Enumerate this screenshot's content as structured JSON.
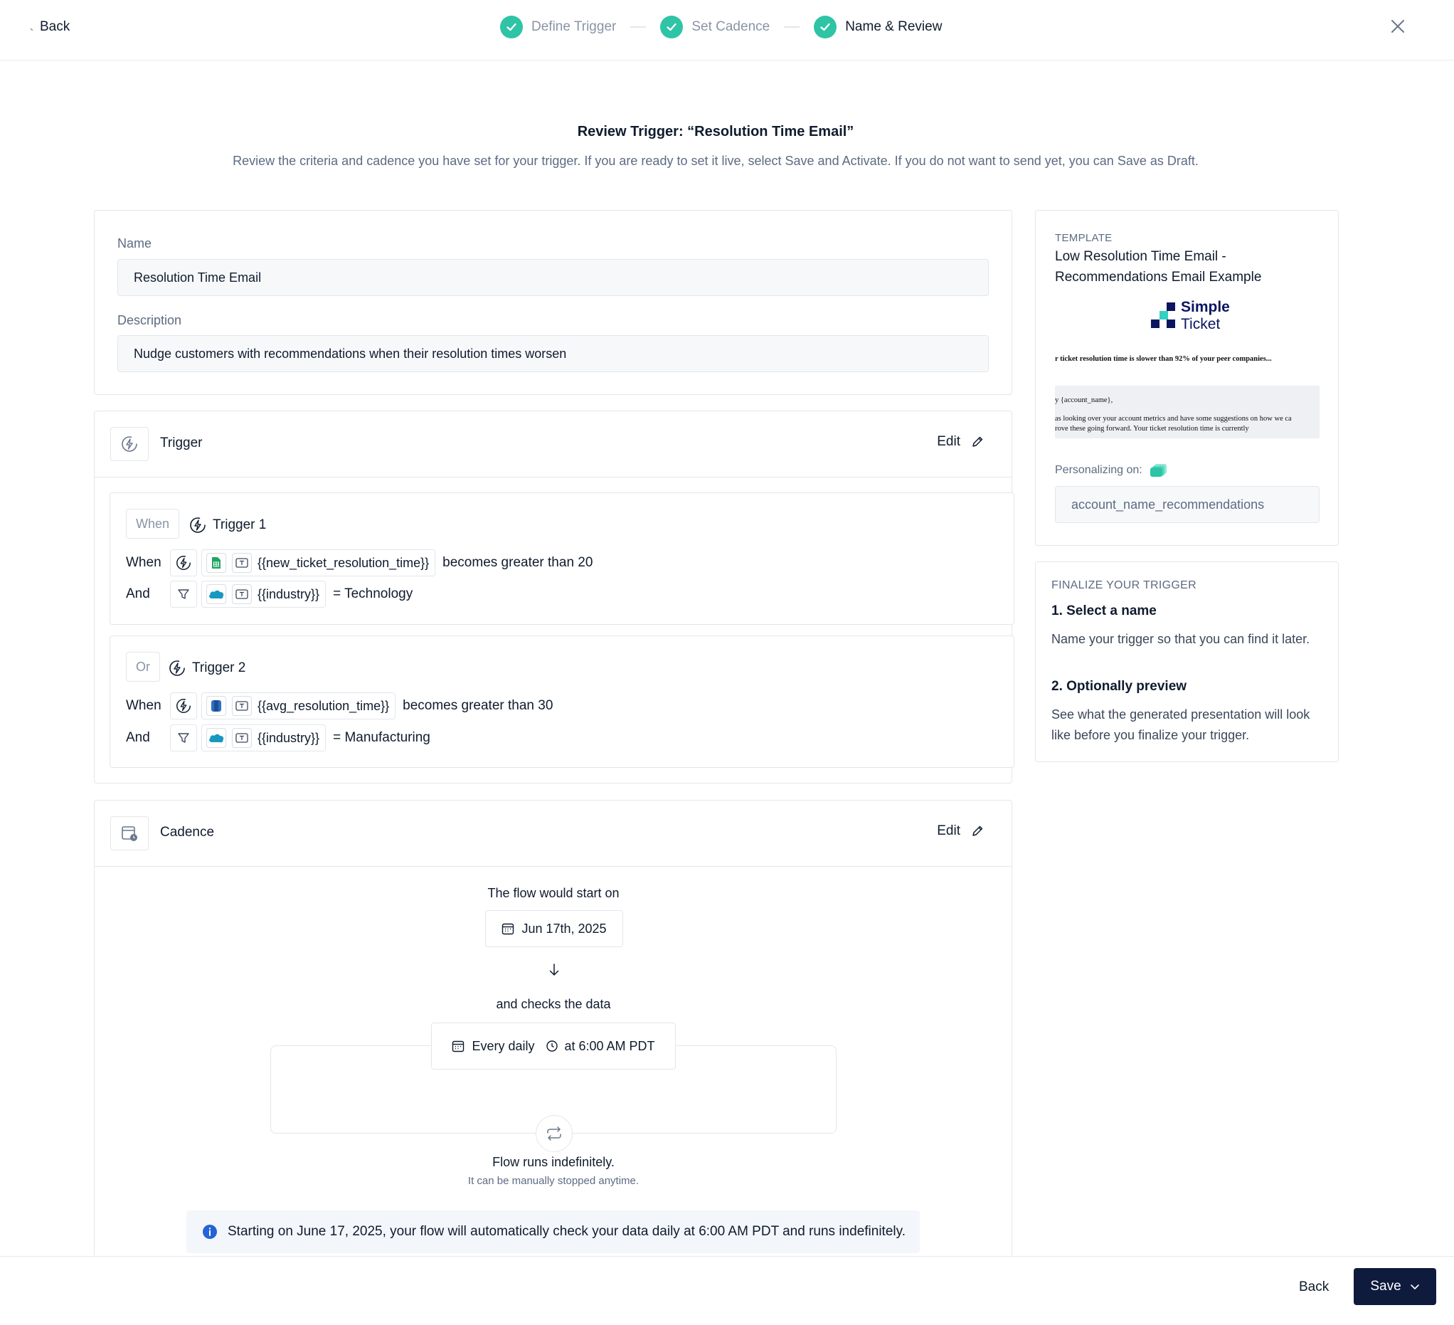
{
  "topbar": {
    "back_label": "Back",
    "steps": [
      {
        "label": "Define Trigger",
        "state": "done"
      },
      {
        "label": "Set Cadence",
        "state": "done"
      },
      {
        "label": "Name & Review",
        "state": "active"
      }
    ]
  },
  "header": {
    "title": "Review Trigger: “Resolution Time Email”",
    "subtitle": "Review the criteria and cadence you have set for your trigger. If you are ready to set it live, select Save and Activate. If you do not want to send yet, you can Save as Draft."
  },
  "details": {
    "name_label": "Name",
    "name_value": "Resolution Time Email",
    "description_label": "Description",
    "description_value": "Nudge customers with recommendations when their resolution times worsen"
  },
  "trigger_section": {
    "title": "Trigger",
    "edit_label": "Edit",
    "groups": [
      {
        "chip": "When",
        "name": "Trigger 1",
        "conditions": [
          {
            "keyword": "When",
            "source": "sheets",
            "variable": "{{new_ticket_resolution_time}}",
            "operator": "becomes greater than 20"
          },
          {
            "keyword": "And",
            "source": "salesforce",
            "variable": "{{industry}}",
            "operator": "= Technology"
          }
        ]
      },
      {
        "chip": "Or",
        "name": "Trigger 2",
        "conditions": [
          {
            "keyword": "When",
            "source": "database",
            "variable": "{{avg_resolution_time}}",
            "operator": "becomes greater than 30"
          },
          {
            "keyword": "And",
            "source": "salesforce",
            "variable": "{{industry}}",
            "operator": "= Manufacturing"
          }
        ]
      }
    ]
  },
  "cadence_section": {
    "title": "Cadence",
    "edit_label": "Edit",
    "start_text": "The flow would start on",
    "start_date": "Jun 17th, 2025",
    "checks_text": "and checks the data",
    "frequency": "Every daily",
    "time": "at 6:00 AM PDT",
    "runs_text": "Flow runs indefinitely.",
    "runs_sub": "It can be manually stopped anytime.",
    "info": "Starting on June 17, 2025, your flow will automatically check your data daily at 6:00 AM PDT and runs indefinitely."
  },
  "template_card": {
    "label": "TEMPLATE",
    "name": "Low Resolution Time Email - Recommendations Email Example",
    "logo_word1": "Simple",
    "logo_word2": "Ticket",
    "preview_lines": [
      "r ticket resolution time is slower than 92% of your peer companies...",
      "y {account_name},",
      "as looking over your account metrics and have some suggestions on how we ca",
      "rove these going forward. Your ticket resolution time is currently"
    ],
    "personalizing_label": "Personalizing on:",
    "personalizing_value": "account_name_recommendations"
  },
  "finalize_card": {
    "heading": "FINALIZE YOUR TRIGGER",
    "step1_title": "1. Select a name",
    "step1_body": "Name your trigger so that you can find it later.",
    "step2_title": "2. Optionally preview",
    "step2_body": "See what the generated presentation will look like before you finalize your trigger."
  },
  "footer": {
    "back_label": "Back",
    "save_label": "Save"
  },
  "colors": {
    "accent_green": "#2ec4a5",
    "primary_navy": "#0f1b3d",
    "muted_text": "#5d6b82"
  }
}
